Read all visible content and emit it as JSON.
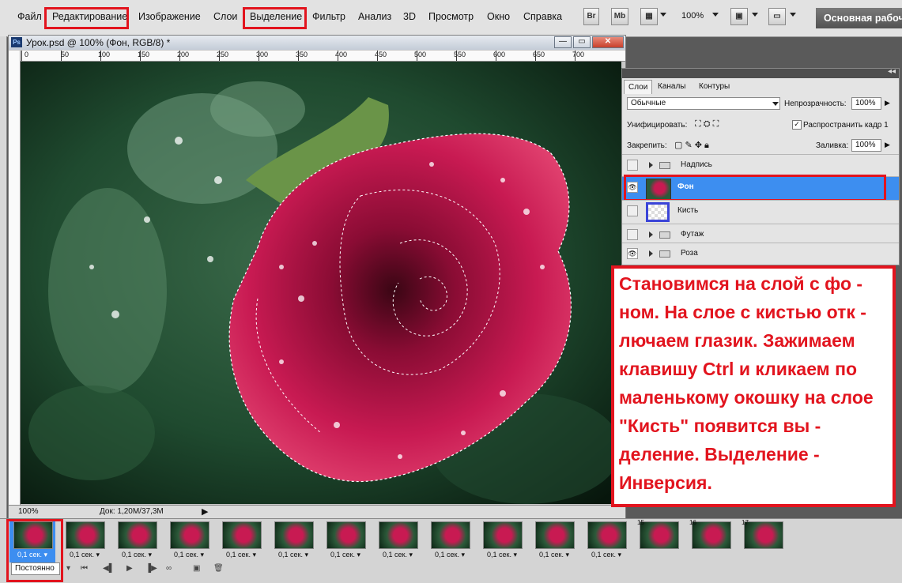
{
  "menu": {
    "items": [
      "Файл",
      "Редактирование",
      "Изображение",
      "Слои",
      "Выделение",
      "Фильтр",
      "Анализ",
      "3D",
      "Просмотр",
      "Окно",
      "Справка"
    ],
    "highlighted": [
      "Редактирование",
      "Выделение"
    ]
  },
  "toolbar": {
    "bridge_label": "Br",
    "minibridge_label": "Mb",
    "zoom_level": "100%",
    "workspace_label": "Основная рабочая среда"
  },
  "document": {
    "title": "Урок.psd @ 100% (Фон, RGB/8) *",
    "ruler_labels": [
      "0",
      "50",
      "100",
      "150",
      "200",
      "250",
      "300",
      "350",
      "400",
      "450",
      "500",
      "550",
      "600",
      "650",
      "700"
    ],
    "zoom_status": "100%",
    "doc_info": "Док: 1,20M/37,3M"
  },
  "layers_panel": {
    "tabs": [
      "Слои",
      "Каналы",
      "Контуры"
    ],
    "blend_mode": "Обычные",
    "opacity_label": "Непрозрачность:",
    "opacity_value": "100%",
    "unify_label": "Унифицировать:",
    "propagate_label": "Распространить кадр 1",
    "lock_label": "Закрепить:",
    "fill_label": "Заливка:",
    "fill_value": "100%",
    "layers": [
      {
        "name": "Надпись",
        "type": "group",
        "visible": false
      },
      {
        "name": "Фон",
        "type": "image",
        "visible": true,
        "selected": true
      },
      {
        "name": "Кисть",
        "type": "transparent",
        "visible": false
      },
      {
        "name": "Футаж",
        "type": "group",
        "visible": false
      },
      {
        "name": "Роза",
        "type": "group",
        "visible": true
      }
    ]
  },
  "callout": {
    "text": "Становимся на слой с фо - ном. На слое с кистью отк - лючаем глазик. Зажимаем клавишу Ctrl и кликаем по маленькому окошку на слое \"Кисть\" появится вы - деление. Выделение - Инверсия."
  },
  "timeline": {
    "frame_time": "0,1 сек.",
    "loop_label": "Постоянно",
    "frame_numbers": [
      "15",
      "16",
      "17"
    ]
  },
  "colors": {
    "highlight_red": "#e2141e",
    "selection_blue": "#3d8ef0",
    "panel_gray": "#e4e4e4"
  }
}
